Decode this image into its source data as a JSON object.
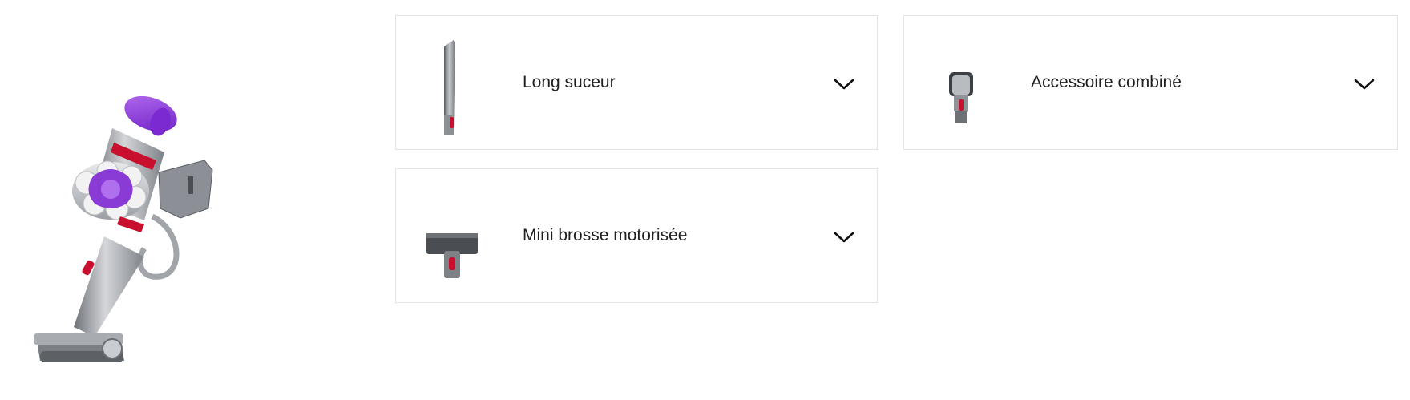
{
  "product": {
    "image_alt": "Aspirateur à main Dyson"
  },
  "accessories": [
    {
      "label": "Long suceur",
      "icon": "crevice-tool-icon",
      "expand_icon": "chevron-down-icon"
    },
    {
      "label": "Accessoire combiné",
      "icon": "combination-tool-icon",
      "expand_icon": "chevron-down-icon"
    },
    {
      "label": "Mini brosse motorisée",
      "icon": "mini-motorized-brush-icon",
      "expand_icon": "chevron-down-icon"
    }
  ],
  "colors": {
    "purple": "#8a3bd6",
    "red": "#c8102e",
    "border": "#e3e3e3"
  }
}
